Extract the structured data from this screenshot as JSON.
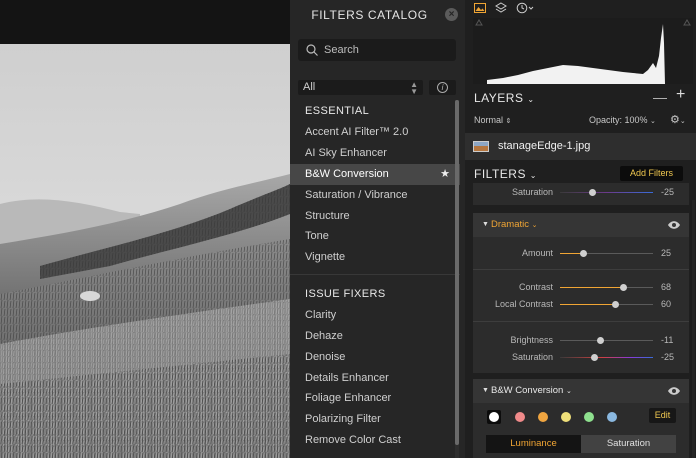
{
  "catalog": {
    "title": "FILTERS CATALOG",
    "close_icon": "close-icon",
    "search_placeholder": "Search",
    "category": "All",
    "sections": [
      {
        "title": "ESSENTIAL",
        "items": [
          "Accent AI Filter™ 2.0",
          "AI Sky Enhancer",
          "B&W Conversion",
          "Saturation / Vibrance",
          "Structure",
          "Tone",
          "Vignette"
        ],
        "selected": "B&W Conversion"
      },
      {
        "title": "ISSUE FIXERS",
        "items": [
          "Clarity",
          "Dehaze",
          "Denoise",
          "Details Enhancer",
          "Foliage Enhancer",
          "Polarizing Filter",
          "Remove Color Cast"
        ]
      }
    ]
  },
  "layers": {
    "title": "LAYERS",
    "blend_mode": "Normal",
    "opacity": "Opacity: 100%",
    "layer_name": "stanageEdge-1.jpg"
  },
  "filters": {
    "title": "FILTERS",
    "add_label": "Add Filters",
    "partial_row": {
      "label": "Saturation",
      "value": "-25",
      "fraction": 0.35
    },
    "dramatic": {
      "name": "Dramatic",
      "amount": {
        "label": "Amount",
        "value": "25",
        "fraction": 0.25
      },
      "contrast": {
        "label": "Contrast",
        "value": "68",
        "fraction": 0.68
      },
      "local_contrast": {
        "label": "Local Contrast",
        "value": "60",
        "fraction": 0.6
      },
      "brightness": {
        "label": "Brightness",
        "value": "-11",
        "fraction": 0.44
      },
      "saturation": {
        "label": "Saturation",
        "value": "-25",
        "fraction": 0.37
      }
    },
    "bw": {
      "name": "B&W Conversion",
      "edit_label": "Edit",
      "dot_colors": [
        "#ffffff",
        "#f08a8a",
        "#f0a540",
        "#f0e07a",
        "#8ee08e",
        "#8ab8e0"
      ],
      "tab_luminance": "Luminance",
      "tab_saturation": "Saturation"
    }
  },
  "colors": {
    "accent": "#f0a534",
    "button_text": "#f0c850"
  }
}
